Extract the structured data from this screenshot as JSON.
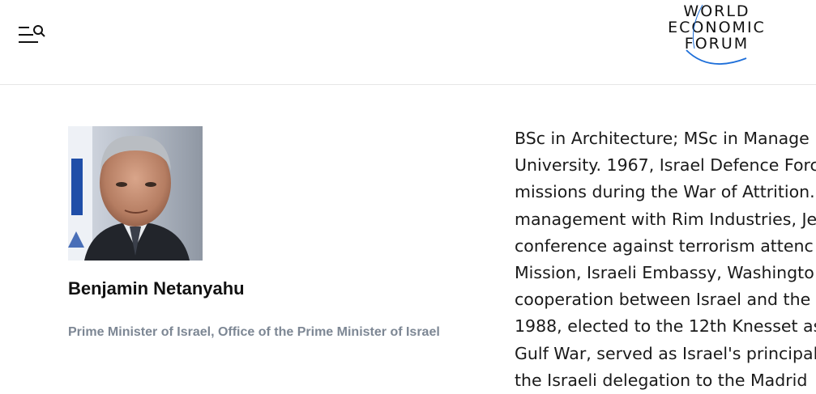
{
  "header": {
    "menu_icon": "hamburger-search-icon",
    "logo": {
      "line1": "WORLD",
      "line2": "ECONOMIC",
      "line3": "FORUM",
      "accent_color": "#1e6fd9"
    }
  },
  "profile": {
    "photo_icon": "portrait-photo",
    "name": "Benjamin Netanyahu",
    "title": "Prime Minister of Israel, Office of the Prime Minister of Israel"
  },
  "bio": {
    "lines": [
      "BSc in Architecture; MSc in Manage",
      "University. 1967, Israel Defence Forc",
      "missions during the War of Attrition.",
      "management with Rim Industries, Je",
      "conference against terrorism attenc",
      "Mission, Israeli Embassy, Washingto",
      "cooperation between Israel and the",
      "1988, elected to the 12th Knesset as",
      "Gulf War, served as Israel's principal",
      "the Israeli delegation to the Madrid"
    ]
  },
  "colors": {
    "text": "#1a1a1a",
    "muted": "#7d8794",
    "divider": "#e6e6e6"
  }
}
